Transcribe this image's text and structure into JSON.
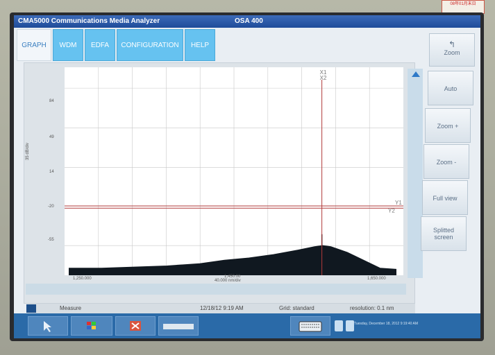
{
  "app": {
    "title": "CMA5000 Communications Media Analyzer",
    "module": "OSA 400"
  },
  "tabs": [
    {
      "label": "GRAPH",
      "active": true
    },
    {
      "label": "WDM",
      "active": false
    },
    {
      "label": "EDFA",
      "active": false
    },
    {
      "label": "CONFIGURATION",
      "active": false
    },
    {
      "label": "HELP",
      "active": false
    }
  ],
  "side_buttons": [
    {
      "label": "Zoom",
      "icon": "arrow-up-left-icon"
    },
    {
      "label": "Auto"
    },
    {
      "label": "Zoom +"
    },
    {
      "label": "Zoom -"
    },
    {
      "label": "Full view"
    },
    {
      "label": "Splitted screen"
    }
  ],
  "graph": {
    "y_ticks": [
      "84",
      "49",
      "14",
      "-20",
      "-55"
    ],
    "y_unit": "35 dB/div",
    "x_ticks": [
      "1,250.000",
      "1,450.00",
      "1,650.000"
    ],
    "x_unit": "40.000 nm/div",
    "markers": {
      "x1": "X1",
      "x2": "X2",
      "y1": "Y1",
      "y2": "Y2"
    }
  },
  "status": {
    "measure": "Measure",
    "datetime": "12/18/12 9:19 AM",
    "grid": "Grid: standard",
    "resolution": "resolution: 0.1 nm"
  },
  "taskbar": {
    "date": "Tuesday, December 18, 2012 9:19:40 AM"
  },
  "sticker": {
    "text": "08年01月末日"
  },
  "colors": {
    "title_bar": "#2a5aa8",
    "tab_active": "#f2f6fa",
    "tab_inactive": "#66c2f0",
    "trace": "#101820",
    "marker_line": "#b23b3b",
    "taskbar": "#2a6aa8"
  },
  "chart_data": {
    "type": "line",
    "y_ticks": [
      84,
      49,
      14,
      -20,
      -55
    ],
    "x_ticks": [
      1250,
      1450,
      1650
    ],
    "series": [
      {
        "points": [
          [
            1250,
            -75
          ],
          [
            1290,
            -75
          ],
          [
            1330,
            -74
          ],
          [
            1370,
            -73
          ],
          [
            1410,
            -71
          ],
          [
            1440,
            -68
          ],
          [
            1470,
            -66
          ],
          [
            1500,
            -63
          ],
          [
            1530,
            -59
          ],
          [
            1550,
            -56
          ],
          [
            1560,
            -55
          ],
          [
            1570,
            -56
          ],
          [
            1590,
            -61
          ],
          [
            1610,
            -68
          ],
          [
            1630,
            -75
          ],
          [
            1650,
            -76
          ]
        ]
      }
    ],
    "peak": [
      1559,
      -45
    ],
    "x1": 1559,
    "x2": 1560,
    "y1": -20,
    "y2": -22,
    "ylim": [
      -80,
      100
    ],
    "xlim": [
      1250,
      1650
    ],
    "grid": true
  }
}
